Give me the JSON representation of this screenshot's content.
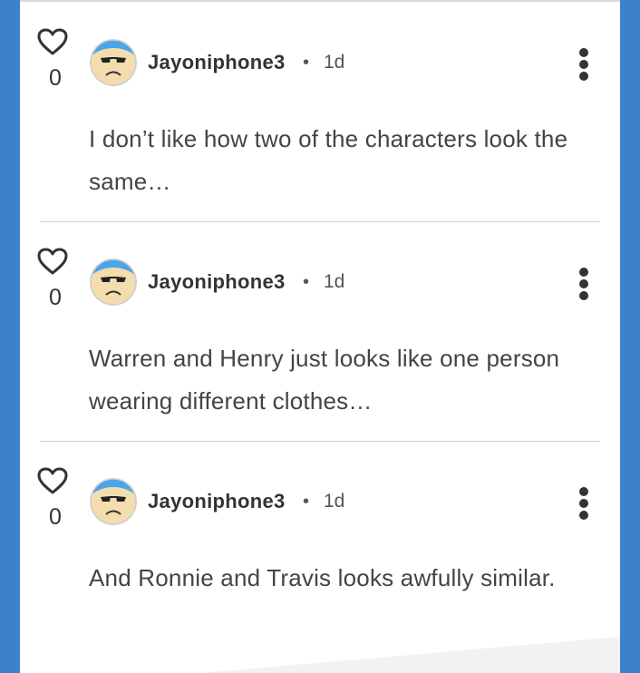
{
  "comments": [
    {
      "likes": "0",
      "author": "Jayoniphone3",
      "separator": "•",
      "time": "1d",
      "text": "I don’t like how two of the characters look the same…"
    },
    {
      "likes": "0",
      "author": "Jayoniphone3",
      "separator": "•",
      "time": "1d",
      "text": "Warren and Henry just looks like one person wearing different clothes…"
    },
    {
      "likes": "0",
      "author": "Jayoniphone3",
      "separator": "•",
      "time": "1d",
      "text": "And Ronnie and Travis looks awfully similar."
    }
  ],
  "icons": {
    "like": "heart-outline-icon",
    "more": "vertical-ellipsis-icon",
    "avatar": "sad-face-sunglasses-avatar"
  },
  "colors": {
    "page_background": "#3d82c8",
    "avatar_hair": "#4aa6e6",
    "avatar_skin": "#f3dcae",
    "text": "#444444"
  }
}
